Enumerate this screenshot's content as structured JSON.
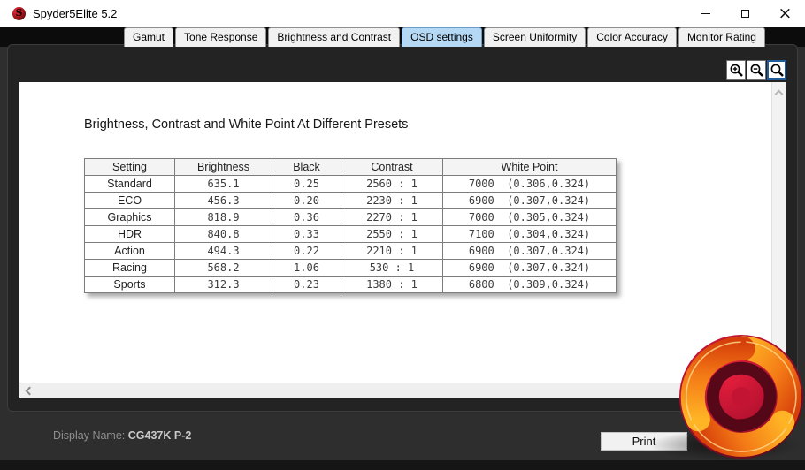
{
  "window": {
    "title": "Spyder5Elite 5.2",
    "control_icons": [
      "minimize-icon",
      "maximize-icon",
      "close-icon"
    ]
  },
  "tabs": {
    "selected": "OSD settings",
    "items": [
      "Gamut",
      "Tone Response",
      "Brightness and Contrast",
      "OSD settings",
      "Screen Uniformity",
      "Color Accuracy",
      "Monitor Rating"
    ]
  },
  "toolbar": {
    "icons": [
      "zoom-in-icon",
      "zoom-out-icon",
      "zoom-reset-icon"
    ],
    "active_icon": "zoom-reset-icon"
  },
  "content": {
    "heading": "Brightness, Contrast and White Point At Different Presets",
    "table": {
      "columns": [
        "Setting",
        "Brightness",
        "Black",
        "Contrast",
        "White Point"
      ],
      "rows": [
        [
          "Standard",
          "635.1",
          "0.25",
          "2560 : 1",
          "7000  (0.306,0.324)"
        ],
        [
          "ECO",
          "456.3",
          "0.20",
          "2230 : 1",
          "6900  (0.307,0.324)"
        ],
        [
          "Graphics",
          "818.9",
          "0.36",
          "2270 : 1",
          "7000  (0.305,0.324)"
        ],
        [
          "HDR",
          "840.8",
          "0.33",
          "2550 : 1",
          "7100  (0.304,0.324)"
        ],
        [
          "Action",
          "494.3",
          "0.22",
          "2210 : 1",
          "6900  (0.307,0.324)"
        ],
        [
          "Racing",
          "568.2",
          "1.06",
          "530 : 1",
          "6900  (0.307,0.324)"
        ],
        [
          "Sports",
          "312.3",
          "0.23",
          "1380 : 1",
          "6800  (0.309,0.324)"
        ]
      ]
    }
  },
  "footer": {
    "display_name_label": "Display Name:",
    "display_name_value": "CG437K P-2",
    "print_label": "Print"
  },
  "branding": {
    "logo": "kitguru-swirl-logo"
  },
  "colors": {
    "titlebar": "#ffffff",
    "tabstrip": "#0c0c0c",
    "body": "#2e2e2e",
    "panel": "#232323",
    "selected_tab": "#b5d9f5",
    "zoom_active_border": "#1f5c99",
    "logo_orange": "#f47b16",
    "logo_red": "#b01030"
  }
}
